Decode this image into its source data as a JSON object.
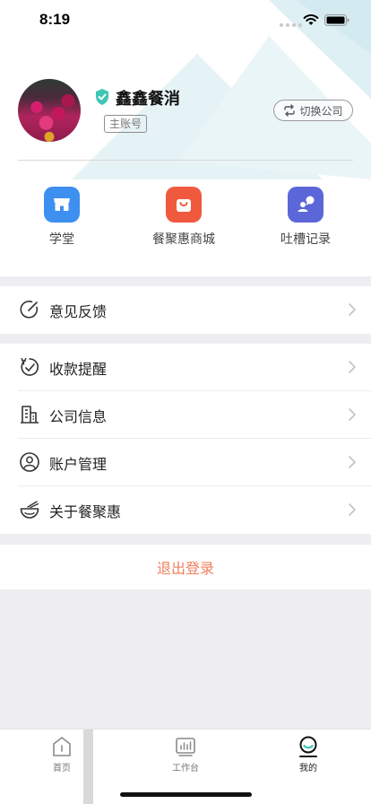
{
  "status_bar": {
    "time": "8:19"
  },
  "profile": {
    "name": "鑫鑫餐消",
    "account_tag": "主账号",
    "switch_label": "切换公司"
  },
  "shortcuts": [
    {
      "label": "学堂",
      "icon": "store-icon",
      "color": "#3d8ff0"
    },
    {
      "label": "餐聚惠商城",
      "icon": "shopping-bag-icon",
      "color": "#ef5a3f"
    },
    {
      "label": "吐槽记录",
      "icon": "chat-user-icon",
      "color": "#5b67d8"
    }
  ],
  "menu": {
    "feedback": "意见反馈",
    "items": [
      {
        "label": "收款提醒",
        "icon": "payment-reminder-icon"
      },
      {
        "label": "公司信息",
        "icon": "building-icon"
      },
      {
        "label": "账户管理",
        "icon": "user-circle-icon"
      },
      {
        "label": "关于餐聚惠",
        "icon": "bowl-icon"
      }
    ]
  },
  "logout_label": "退出登录",
  "tabbar": {
    "tabs": [
      {
        "label": "首页",
        "icon": "home-icon",
        "active": false
      },
      {
        "label": "工作台",
        "icon": "dashboard-icon",
        "active": false
      },
      {
        "label": "我的",
        "icon": "profile-icon",
        "active": true
      }
    ]
  },
  "colors": {
    "verify": "#3cc7b4",
    "logout": "#f07f5c"
  }
}
